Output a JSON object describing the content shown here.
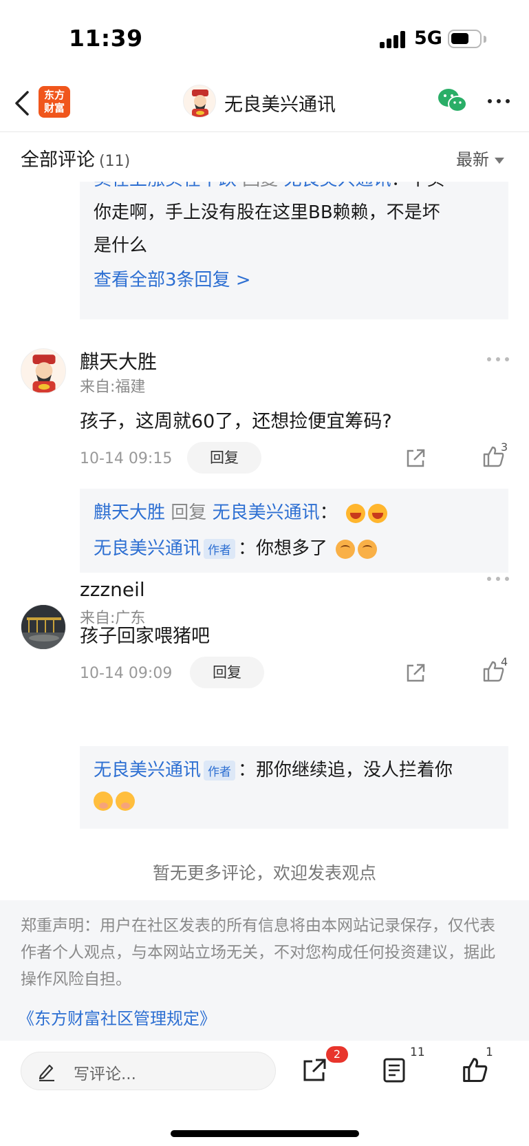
{
  "status_bar": {
    "time": "11:39",
    "network": "5G"
  },
  "nav": {
    "title": "无良美兴通讯",
    "brand_logo_line1": "东方",
    "brand_logo_line2": "财富",
    "icons": [
      "back-icon",
      "wechat-icon",
      "more-icon"
    ]
  },
  "comments_header": {
    "title": "全部评论",
    "count": "(11)",
    "sort_label": "最新"
  },
  "truncated_reply": {
    "user": "卖在上涨买在下跌",
    "action": "回复",
    "target": "无良美兴通讯",
    "colon": "：",
    "text_line1": "不买",
    "text_line2": "你走啊，手上没有股在这里BB赖赖，不是坏",
    "text_line3": "是什么",
    "view_all": "查看全部3条回复 >"
  },
  "comments": [
    {
      "username": "麒天大胜",
      "location": "来自:福建",
      "text": "孩子，这周就60了，还想捡便宜筹码?",
      "time": "10-14 09:15",
      "reply_label": "回复",
      "likes": "3",
      "replies": [
        {
          "user": "麒天大胜",
          "action": "回复",
          "target": "无良美兴通讯",
          "colon": "：",
          "emoji": [
            "laugh-emoji",
            "laugh-emoji"
          ]
        },
        {
          "user": "无良美兴通讯",
          "tag": "作者",
          "colon": "：",
          "text": "你想多了",
          "emoji": [
            "dizzy-emoji",
            "dizzy-emoji"
          ]
        }
      ]
    },
    {
      "username": "zzzneil",
      "location": "来自:广东",
      "text": "孩子回家喂猪吧",
      "time": "10-14 09:09",
      "reply_label": "回复",
      "likes": "4",
      "replies": [
        {
          "user": "无良美兴通讯",
          "tag": "作者",
          "colon": "：",
          "text": "那你继续追，没人拦着你",
          "emoji": [
            "hush-emoji",
            "hush-emoji"
          ]
        }
      ]
    }
  ],
  "no_more_text": "暂无更多评论，欢迎发表观点",
  "disclaimer": {
    "text": "郑重声明：用户在社区发表的所有信息将由本网站记录保存，仅代表作者个人观点，与本网站立场无关，不对您构成任何投资建议，据此操作风险自担。",
    "link": "《东方财富社区管理规定》"
  },
  "bottom_bar": {
    "input_placeholder": "写评论...",
    "share_badge": "2",
    "comment_count": "11",
    "like_count": "1"
  },
  "colors": {
    "link_blue": "#2d6fd2",
    "brand_orange": "#f0561c",
    "badge_red": "#e8352c",
    "wechat_green": "#2aae67"
  }
}
